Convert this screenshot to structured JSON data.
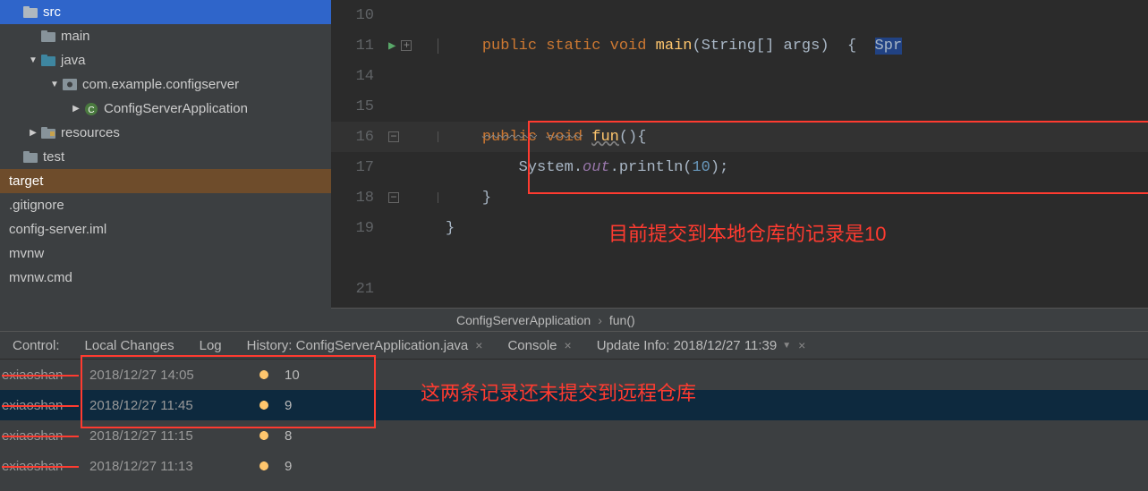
{
  "tree": {
    "items": [
      {
        "label": "src",
        "indent": 0,
        "icon": "folder",
        "arrow": "",
        "selected": true
      },
      {
        "label": "main",
        "indent": 1,
        "icon": "folder",
        "arrow": ""
      },
      {
        "label": "java",
        "indent": 1,
        "icon": "folder-blue",
        "arrow": "▼"
      },
      {
        "label": "com.example.configserver",
        "indent": 2,
        "icon": "package",
        "arrow": "▼"
      },
      {
        "label": "ConfigServerApplication",
        "indent": 3,
        "icon": "class",
        "arrow": "▶"
      },
      {
        "label": "resources",
        "indent": 1,
        "icon": "folder",
        "arrow": "▶"
      },
      {
        "label": "test",
        "indent": 0,
        "icon": "folder",
        "arrow": ""
      },
      {
        "label": "target",
        "indent": 0,
        "icon": "folder",
        "arrow": "",
        "target": true
      },
      {
        "label": ".gitignore",
        "indent": 0,
        "icon": "file",
        "arrow": ""
      },
      {
        "label": "config-server.iml",
        "indent": 0,
        "icon": "file",
        "arrow": ""
      },
      {
        "label": "mvnw",
        "indent": 0,
        "icon": "file",
        "arrow": ""
      },
      {
        "label": "mvnw.cmd",
        "indent": 0,
        "icon": "file",
        "arrow": ""
      }
    ]
  },
  "editor": {
    "lines": [
      {
        "num": "10",
        "run": false,
        "fold": ""
      },
      {
        "num": "11",
        "run": true,
        "fold": "+"
      },
      {
        "num": "14",
        "run": false,
        "fold": ""
      },
      {
        "num": "15",
        "run": false,
        "fold": ""
      },
      {
        "num": "16",
        "run": false,
        "fold": "-",
        "current": true
      },
      {
        "num": "17",
        "run": false,
        "fold": ""
      },
      {
        "num": "18",
        "run": false,
        "fold": "-"
      },
      {
        "num": "19",
        "run": false,
        "fold": ""
      },
      {
        "num": "",
        "run": false,
        "fold": ""
      },
      {
        "num": "21",
        "run": false,
        "fold": ""
      }
    ],
    "code": {
      "kw_public": "public",
      "kw_static": "static",
      "kw_void": "void",
      "fn_main": "main",
      "ty_string": "String",
      "arg_args": "args",
      "brace_open": "{",
      "brace_close": "}",
      "sel_spr": "Spr",
      "fn_fun": "fun",
      "paren_empty": "()",
      "ty_system": "System",
      "it_out": "out",
      "fn_println": "println",
      "num_10": "10"
    },
    "breadcrumb": {
      "item1": "ConfigServerApplication",
      "item2": "fun()"
    }
  },
  "annotations": {
    "red1": "目前提交到本地仓库的记录是10",
    "red2": "这两条记录还未提交到远程仓库"
  },
  "vc": {
    "tabs": {
      "control": "Control:",
      "local_changes": "Local Changes",
      "log": "Log",
      "history": "History: ConfigServerApplication.java",
      "console": "Console",
      "update_info": "Update Info: 2018/12/27 11:39"
    },
    "rows": [
      {
        "author": "exiaoshan",
        "date": "2018/12/27 14:05",
        "msg": "10",
        "selected": false
      },
      {
        "author": "exiaoshan",
        "date": "2018/12/27 11:45",
        "msg": "9",
        "selected": true
      },
      {
        "author": "exiaoshan",
        "date": "2018/12/27 11:15",
        "msg": "8",
        "selected": false
      },
      {
        "author": "exiaoshan",
        "date": "2018/12/27 11:13",
        "msg": "9",
        "selected": false
      }
    ]
  }
}
